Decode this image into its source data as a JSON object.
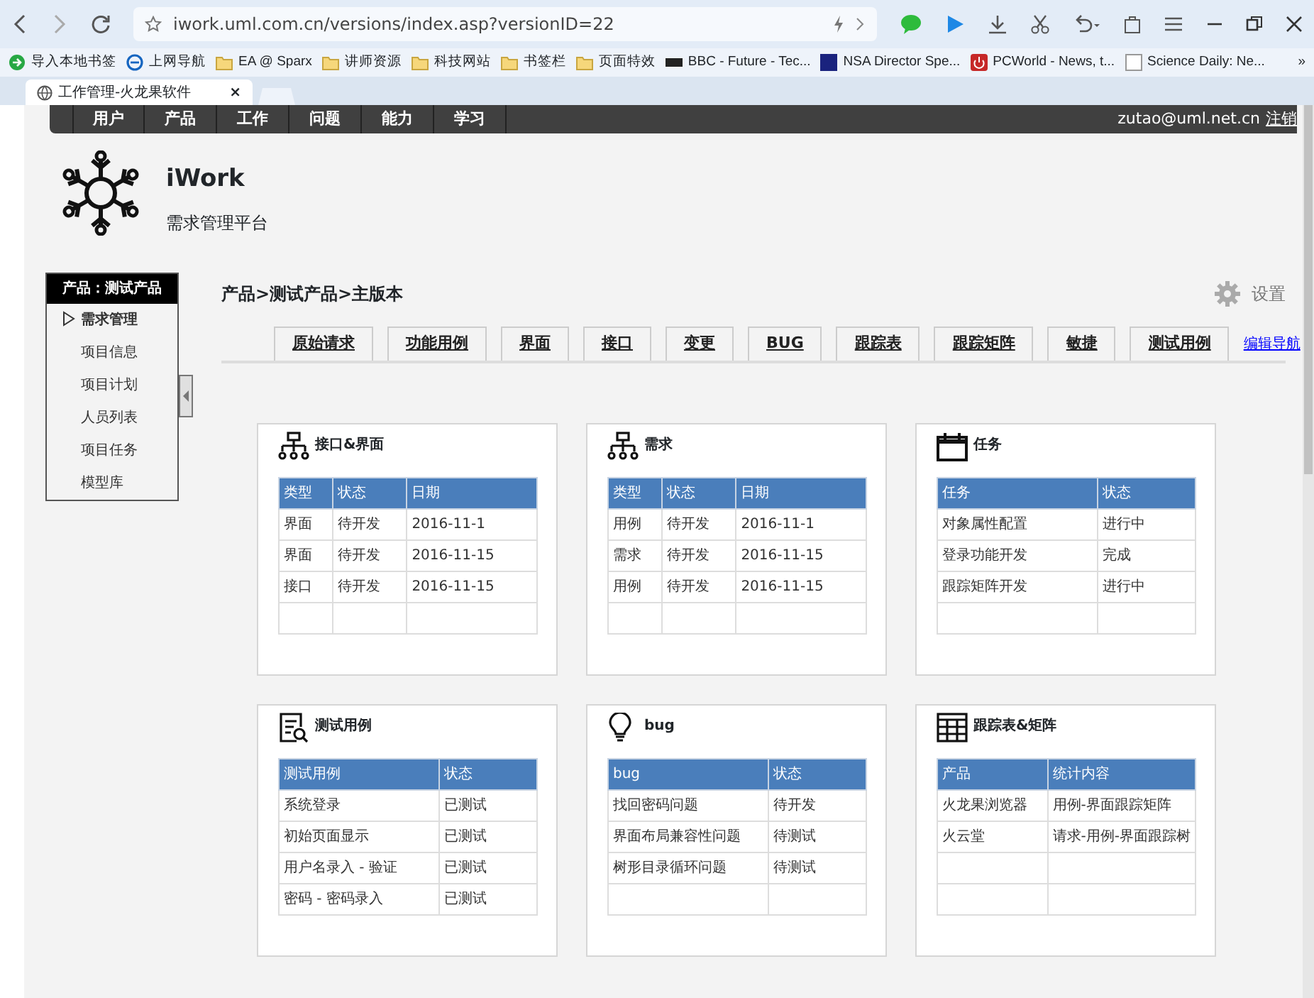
{
  "browser": {
    "url": "iwork.uml.com.cn/versions/index.asp?versionID=22",
    "bookmarks": [
      {
        "kind": "import",
        "label": "导入本地书签"
      },
      {
        "kind": "ie",
        "label": "上网导航"
      },
      {
        "kind": "folder",
        "label": "EA @ Sparx"
      },
      {
        "kind": "folder",
        "label": "讲师资源"
      },
      {
        "kind": "folder",
        "label": "科技网站"
      },
      {
        "kind": "folder",
        "label": "书签栏"
      },
      {
        "kind": "folder",
        "label": "页面特效"
      },
      {
        "kind": "dark",
        "label": "BBC - Future - Tec..."
      },
      {
        "kind": "navy",
        "label": "NSA Director Spe..."
      },
      {
        "kind": "power",
        "label": "PCWorld - News, t..."
      },
      {
        "kind": "plain",
        "label": "Science Daily: Ne..."
      }
    ],
    "more": "»",
    "tab_title": "工作管理-火龙果软件",
    "tab_close": "×"
  },
  "topnav": {
    "items": [
      "用户",
      "产品",
      "工作",
      "问题",
      "能力",
      "学习"
    ],
    "user": "zutao@uml.net.cn",
    "logout": "注销"
  },
  "header": {
    "title": "iWork",
    "subtitle": "需求管理平台"
  },
  "sidebar": {
    "title": "产品：测试产品",
    "items": [
      {
        "label": "需求管理",
        "selected": true
      },
      {
        "label": "项目信息",
        "selected": false
      },
      {
        "label": "项目计划",
        "selected": false
      },
      {
        "label": "人员列表",
        "selected": false
      },
      {
        "label": "项目任务",
        "selected": false
      },
      {
        "label": "模型库",
        "selected": false
      }
    ]
  },
  "breadcrumb": "产品>测试产品>主版本",
  "settings": "设置",
  "tabs": [
    "原始请求",
    "功能用例",
    "界面",
    "接口",
    "变更",
    "BUG",
    "跟踪表",
    "跟踪矩阵",
    "敏捷",
    "测试用例"
  ],
  "edit_nav": "编辑导航",
  "cards": [
    {
      "kind": "hierarchy",
      "title": "接口&界面",
      "columns": [
        "类型",
        "状态",
        "日期"
      ],
      "rows": [
        [
          "界面",
          "待开发",
          "2016-11-1"
        ],
        [
          "界面",
          "待开发",
          "2016-11-15"
        ],
        [
          "接口",
          "待开发",
          "2016-11-15"
        ]
      ]
    },
    {
      "kind": "hierarchy",
      "title": "需求",
      "columns": [
        "类型",
        "状态",
        "日期"
      ],
      "rows": [
        [
          "用例",
          "待开发",
          "2016-11-1"
        ],
        [
          "需求",
          "待开发",
          "2016-11-15"
        ],
        [
          "用例",
          "待开发",
          "2016-11-15"
        ]
      ]
    },
    {
      "kind": "calendar",
      "title": "任务",
      "columns": [
        "任务",
        "状态"
      ],
      "rows": [
        [
          "对象属性配置",
          "进行中"
        ],
        [
          "登录功能开发",
          "完成"
        ],
        [
          "跟踪矩阵开发",
          "进行中"
        ]
      ]
    },
    {
      "kind": "doc-search",
      "title": "测试用例",
      "columns": [
        "测试用例",
        "状态"
      ],
      "rows": [
        [
          "系统登录",
          "已测试"
        ],
        [
          "初始页面显示",
          "已测试"
        ],
        [
          "用户名录入 - 验证",
          "已测试"
        ],
        [
          "密码 - 密码录入",
          "已测试"
        ]
      ]
    },
    {
      "kind": "bulb",
      "title": "bug",
      "columns": [
        "bug",
        "状态"
      ],
      "rows": [
        [
          "找回密码问题",
          "待开发"
        ],
        [
          "界面布局兼容性问题",
          "待测试"
        ],
        [
          "树形目录循环问题",
          "待测试"
        ]
      ]
    },
    {
      "kind": "grid",
      "title": "跟踪表&矩阵",
      "columns": [
        "产品",
        "统计内容"
      ],
      "rows": [
        [
          "火龙果浏览器",
          "用例-界面跟踪矩阵"
        ],
        [
          "火云堂",
          "请求-用例-界面跟踪树"
        ]
      ]
    }
  ]
}
